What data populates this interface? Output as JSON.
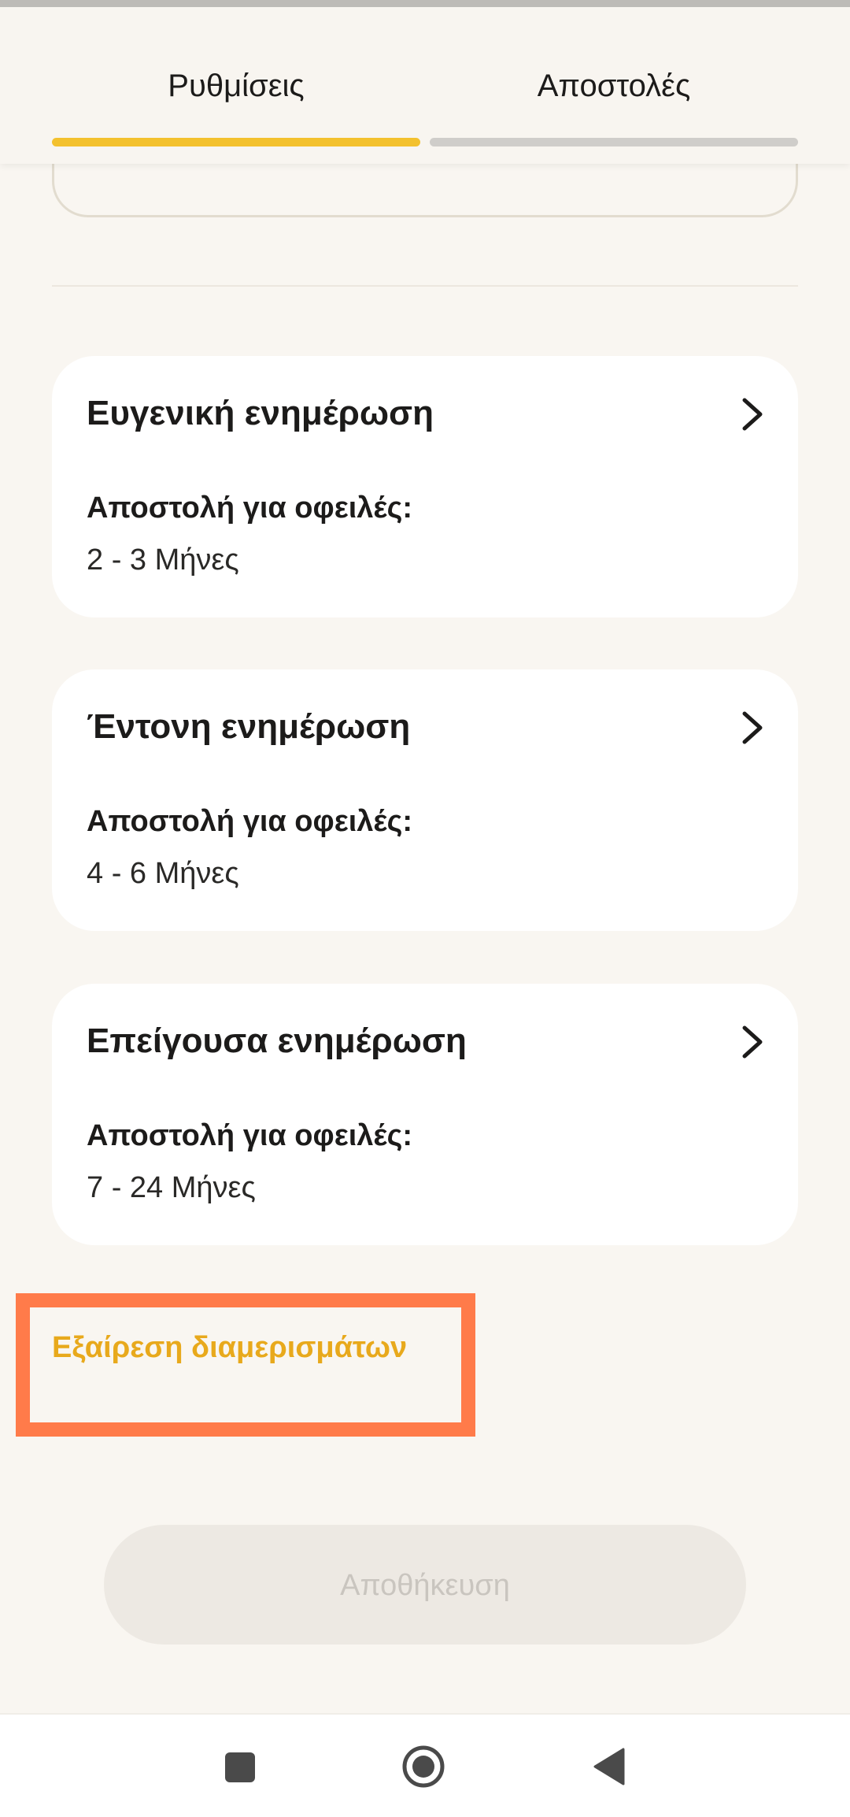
{
  "tabs": [
    {
      "label": "Ρυθμίσεις",
      "active": true
    },
    {
      "label": "Αποστολές",
      "active": false
    }
  ],
  "colors": {
    "accent": "#f3c12e",
    "inactive_tab": "#cfcdca",
    "link": "#e8a91c",
    "highlight": "#ff7b4a"
  },
  "cards": [
    {
      "title": "Ευγενική ενημέρωση",
      "subtitle": "Αποστολή για οφειλές:",
      "value": "2 - 3 Μήνες"
    },
    {
      "title": "Έντονη ενημέρωση",
      "subtitle": "Αποστολή για οφειλές:",
      "value": "4 - 6 Μήνες"
    },
    {
      "title": "Επείγουσα ενημέρωση",
      "subtitle": "Αποστολή για οφειλές:",
      "value": "7 - 24 Μήνες"
    }
  ],
  "exclusion_link": "Εξαίρεση διαμερισμάτων",
  "save_button": "Αποθήκευση",
  "nav": {
    "recents_icon": "square-icon",
    "home_icon": "circle-icon",
    "back_icon": "triangle-back-icon"
  }
}
